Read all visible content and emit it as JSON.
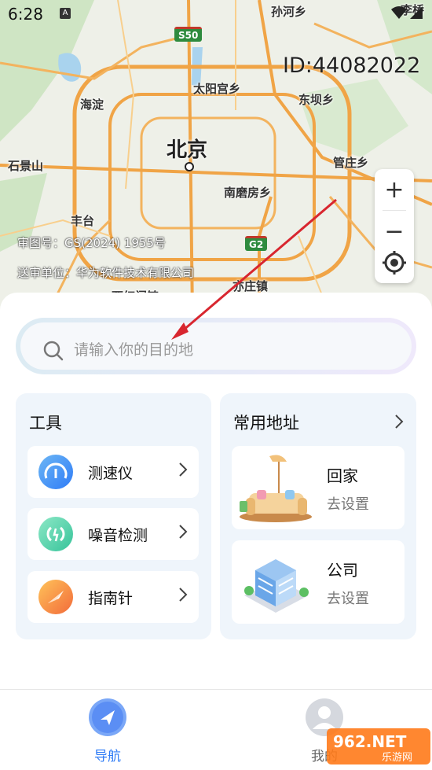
{
  "status_bar": {
    "time": "6:28",
    "notif_glyph": "A"
  },
  "map": {
    "places": {
      "sunhe": "孙河乡",
      "liqiao": "李桥",
      "taiyanggong": "太阳宫乡",
      "dongba": "东坝乡",
      "haidian": "海淀",
      "beijing": "北京",
      "shijingshan": "石景山",
      "guanzhuang": "管庄乡",
      "nanmofang": "南磨房乡",
      "fengtai": "丰台",
      "yizhuang": "亦庄镇",
      "bottom_partial": "西红门镇"
    },
    "shields": {
      "s50": "S50",
      "g2": "G2"
    },
    "colors": {
      "road": "#f0a446",
      "park": "#cfe5c4",
      "water": "#a9d3ee"
    }
  },
  "overlay": {
    "id_text": "ID:44082022",
    "approval_line1": "审图号：GS(2024) 1955号",
    "approval_line2": "送审单位：华为软件技术有限公司"
  },
  "zoom": {
    "plus": "+",
    "minus": "−"
  },
  "search": {
    "placeholder": "请输入你的目的地"
  },
  "tools": {
    "title": "工具",
    "items": [
      {
        "label": "测速仪",
        "icon": "speedometer-icon"
      },
      {
        "label": "噪音检测",
        "icon": "noise-icon"
      },
      {
        "label": "指南针",
        "icon": "compass-icon"
      }
    ]
  },
  "addresses": {
    "title": "常用地址",
    "items": [
      {
        "name": "回家",
        "sub": "去设置",
        "icon": "home-sofa-icon"
      },
      {
        "name": "公司",
        "sub": "去设置",
        "icon": "office-building-icon"
      }
    ]
  },
  "tabbar": {
    "nav_label": "导航",
    "me_label": "我的",
    "active_color": "#2f7cf6"
  },
  "watermark": {
    "text": "962.NET",
    "sub": "乐游网"
  }
}
